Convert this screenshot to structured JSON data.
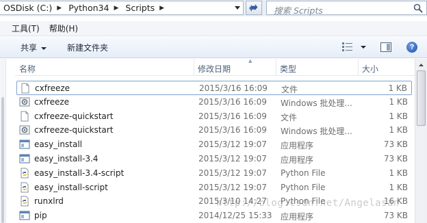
{
  "address": {
    "crumbs": [
      "OSDisk (C:)",
      "Python34",
      "Scripts"
    ]
  },
  "search": {
    "placeholder": "搜索 Scripts"
  },
  "menu": {
    "items": [
      "工具(T)",
      "帮助(H)"
    ]
  },
  "toolbar": {
    "share_label": "共享",
    "new_folder_label": "新建文件夹"
  },
  "columns": {
    "name": "名称",
    "date": "修改日期",
    "type": "类型",
    "size": "大小"
  },
  "files": [
    {
      "name": "cxfreeze",
      "date": "2015/3/16 16:09",
      "type": "文件",
      "size": "1 KB",
      "icon": "blank-file-icon"
    },
    {
      "name": "cxfreeze",
      "date": "2015/3/16 16:09",
      "type": "Windows 批处理...",
      "size": "1 KB",
      "icon": "batch-file-icon"
    },
    {
      "name": "cxfreeze-quickstart",
      "date": "2015/3/16 16:09",
      "type": "文件",
      "size": "1 KB",
      "icon": "blank-file-icon"
    },
    {
      "name": "cxfreeze-quickstart",
      "date": "2015/3/16 16:09",
      "type": "Windows 批处理...",
      "size": "1 KB",
      "icon": "batch-file-icon"
    },
    {
      "name": "easy_install",
      "date": "2015/3/12 19:07",
      "type": "应用程序",
      "size": "73 KB",
      "icon": "exe-icon"
    },
    {
      "name": "easy_install-3.4",
      "date": "2015/3/12 19:07",
      "type": "应用程序",
      "size": "73 KB",
      "icon": "exe-icon"
    },
    {
      "name": "easy_install-3.4-script",
      "date": "2015/3/12 19:07",
      "type": "Python File",
      "size": "1 KB",
      "icon": "python-file-icon"
    },
    {
      "name": "easy_install-script",
      "date": "2015/3/12 19:07",
      "type": "Python File",
      "size": "1 KB",
      "icon": "python-file-icon"
    },
    {
      "name": "runxlrd",
      "date": "2015/3/10 14:27",
      "type": "Python File",
      "size": "16 KB",
      "icon": "python-file-icon"
    },
    {
      "name": "pip",
      "date": "2014/12/25 15:33",
      "type": "应用程序",
      "size": "73 KB",
      "icon": "exe-icon"
    }
  ],
  "watermark": "http://blog.csdn.net/Angelasan",
  "colors": {
    "focus_border": "#7da2ce",
    "toolbar_top": "#f7faff",
    "toolbar_bottom": "#e6edf7",
    "header_text": "#4c607a"
  }
}
